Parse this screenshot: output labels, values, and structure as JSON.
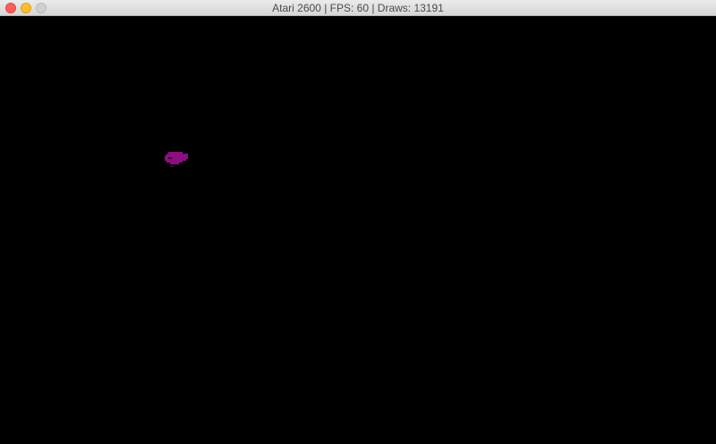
{
  "window": {
    "title": "Atari 2600 | FPS: 60 | Draws: 13191"
  },
  "colors": {
    "background": "#000000",
    "sprite": "#8a0f80",
    "sprite_dark": "#3a0535"
  },
  "sprite": {
    "icon": "magenta-sprite-icon"
  }
}
